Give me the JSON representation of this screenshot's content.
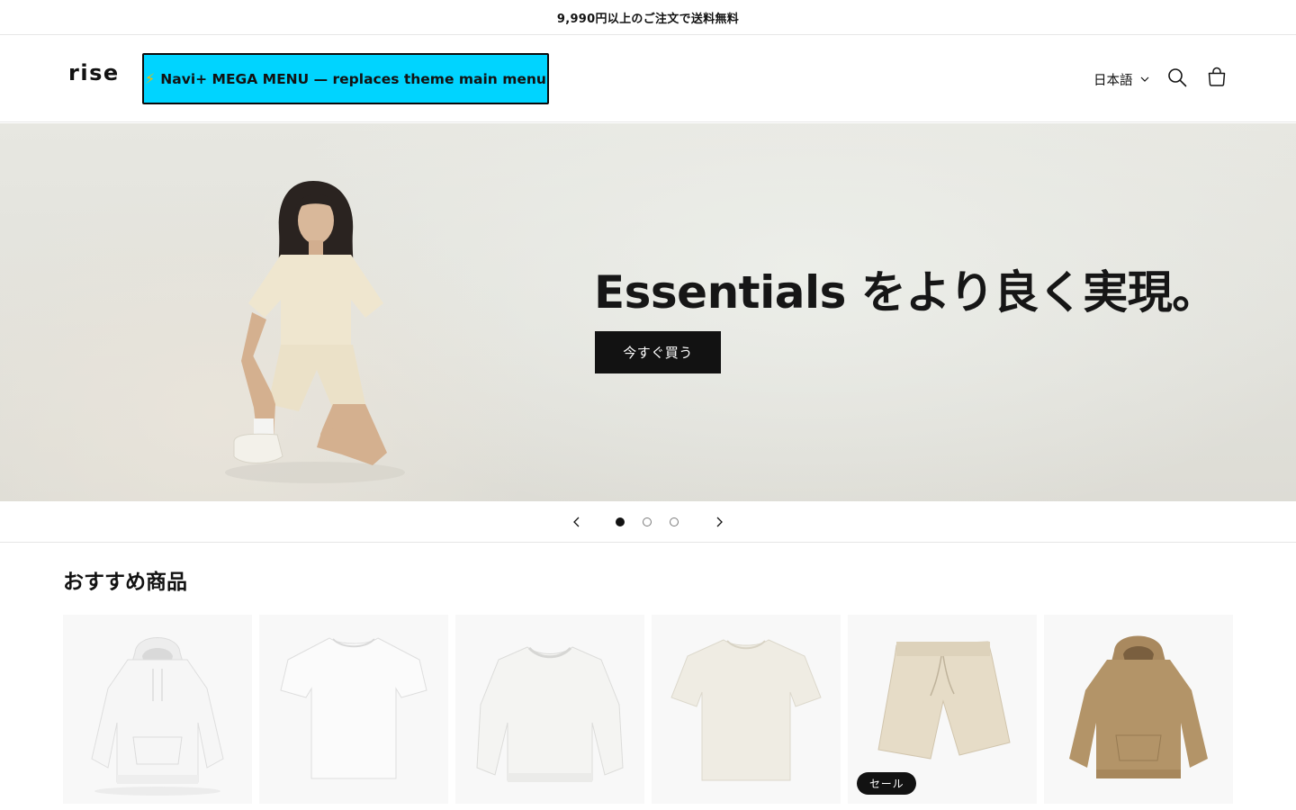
{
  "announcement": {
    "text": "9,990円以上のご注文で送料無料"
  },
  "header": {
    "logo": "rise",
    "mega_menu_label": "Navi+ MEGA MENU — replaces theme main menu",
    "mega_menu_icon": "lightning-bolt-icon",
    "language": "日本語",
    "icons": [
      "search-icon",
      "cart-icon",
      "chevron-down-icon"
    ]
  },
  "hero": {
    "heading": "Essentials をより良く実現。",
    "cta_label": "今すぐ買う"
  },
  "slider": {
    "slide_count": 3,
    "active_slide": 1,
    "prev_icon": "chevron-left-icon",
    "next_icon": "chevron-right-icon"
  },
  "featured": {
    "title": "おすすめ商品",
    "products": [
      {
        "image": "white-hoodie"
      },
      {
        "image": "white-tshirt"
      },
      {
        "image": "white-sweatshirt"
      },
      {
        "image": "cream-tshirt"
      },
      {
        "image": "beige-shorts",
        "badge": "セール"
      },
      {
        "image": "tan-hoodie"
      }
    ]
  },
  "colors": {
    "accent": "#00d4ff",
    "text": "#121212",
    "button_bg": "#121212",
    "border": "#e6e6e6"
  }
}
